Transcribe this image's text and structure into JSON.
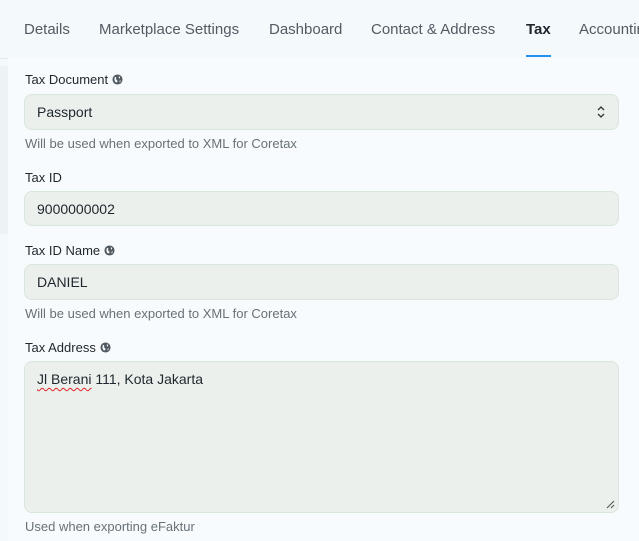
{
  "tabs": [
    {
      "label": "Details",
      "active": false
    },
    {
      "label": "Marketplace Settings",
      "active": false
    },
    {
      "label": "Dashboard",
      "active": false
    },
    {
      "label": "Contact & Address",
      "active": false
    },
    {
      "label": "Tax",
      "active": true
    },
    {
      "label": "Accounting",
      "active": false
    }
  ],
  "tax_document": {
    "label": "Tax Document",
    "value": "Passport",
    "help": "Will be used when exported to XML for Coretax"
  },
  "tax_id": {
    "label": "Tax ID",
    "value": "9000000002"
  },
  "tax_id_name": {
    "label": "Tax ID Name",
    "value": "DANIEL",
    "help": "Will be used when exported to XML for Coretax"
  },
  "tax_address": {
    "label": "Tax Address",
    "value_misspelled": "Jl Berani",
    "value_rest": " 111, Kota Jakarta",
    "help": "Used when exporting eFaktur"
  },
  "colors": {
    "accent": "#2490ef",
    "field_bg": "#ebf0ec",
    "text": "#1f272e",
    "muted": "#687178"
  },
  "icons": [
    "globe-icon",
    "select-arrows-icon",
    "resize-handle-icon"
  ]
}
